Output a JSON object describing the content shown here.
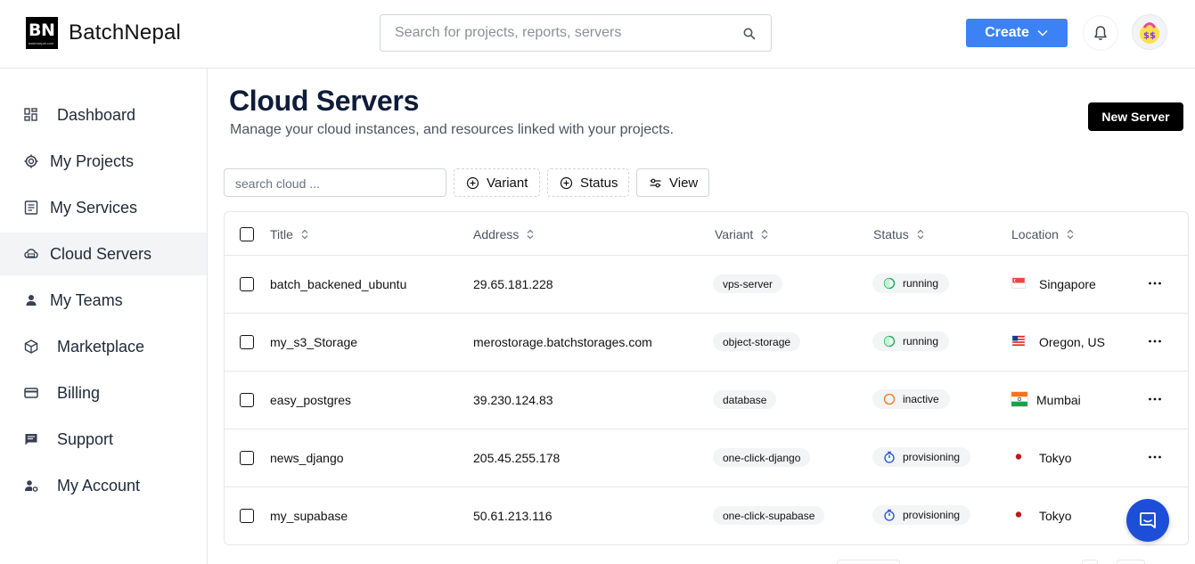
{
  "header": {
    "logo_text": "BN",
    "logo_small_text": "batchnepal.com",
    "brand": "BatchNepal",
    "search_placeholder": "Search for projects, reports, servers",
    "create_label": "Create",
    "colors": {
      "primary": "#3b82f6",
      "chat": "#1d4ed8"
    }
  },
  "sidebar": {
    "items": [
      {
        "label": "Dashboard",
        "icon": "grid-icon"
      },
      {
        "label": "My Projects",
        "icon": "cog-icon"
      },
      {
        "label": "My Services",
        "icon": "list-box-icon"
      },
      {
        "label": "Cloud Servers",
        "icon": "cloud-icon",
        "active": true
      },
      {
        "label": "My Teams",
        "icon": "person-icon"
      },
      {
        "label": "Marketplace",
        "icon": "cube-icon"
      },
      {
        "label": "Billing",
        "icon": "card-icon"
      },
      {
        "label": "Support",
        "icon": "chat-icon"
      },
      {
        "label": "My Account",
        "icon": "user-settings-icon"
      }
    ]
  },
  "page": {
    "title": "Cloud Servers",
    "subtitle": "Manage your cloud instances, and resources linked with your projects.",
    "new_server_label": "New Server",
    "filter_placeholder": "search cloud ...",
    "variant_label": "Variant",
    "status_label": "Status",
    "view_label": "View"
  },
  "table": {
    "columns": [
      "Title",
      "Address",
      "Variant",
      "Status",
      "Location"
    ],
    "rows": [
      {
        "title": "batch_backened_ubuntu",
        "address": "29.65.181.228",
        "variant": "vps-server",
        "status": "running",
        "location": "Singapore",
        "flag": "sg"
      },
      {
        "title": "my_s3_Storage",
        "address": "merostorage.batchstorages.com",
        "variant": "object-storage",
        "status": "running",
        "location": "Oregon, US",
        "flag": "us"
      },
      {
        "title": "easy_postgres",
        "address": "39.230.124.83",
        "variant": "database",
        "status": "inactive",
        "location": "Mumbai",
        "flag": "in"
      },
      {
        "title": "news_django",
        "address": "205.45.255.178",
        "variant": "one-click-django",
        "status": "provisioning",
        "location": "Tokyo",
        "flag": "jp"
      },
      {
        "title": "my_supabase",
        "address": "50.61.213.116",
        "variant": "one-click-supabase",
        "status": "provisioning",
        "location": "Tokyo",
        "flag": "jp"
      }
    ]
  }
}
